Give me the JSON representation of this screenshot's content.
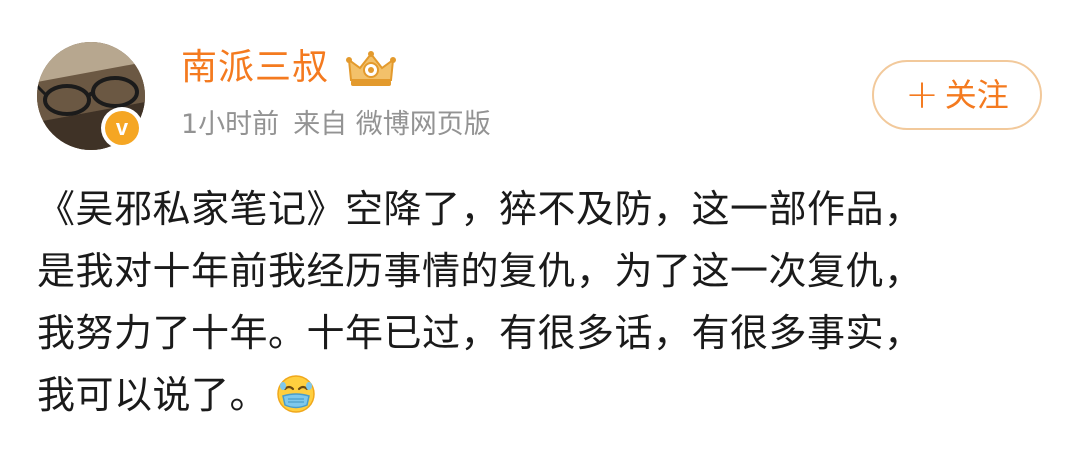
{
  "post": {
    "author": {
      "username": "南派三叔",
      "avatar_icon": "avatar-glasses-photo",
      "verified_icon": "verified-badge-icon",
      "verified_symbol": "v",
      "vip_icon": "crown-icon"
    },
    "meta": {
      "time": "1小时前",
      "source": "来自 微博网页版"
    },
    "follow_button": {
      "plus": "+",
      "label": "关注"
    },
    "content_lines": [
      "《吴邪私家笔记》空降了，猝不及防，这一部作品，",
      "是我对十年前我经历事情的复仇，为了这一次复仇，",
      "我努力了十年。十年已过，有很多话，有很多事实，",
      "我可以说了。"
    ],
    "emoji_icon": "face-with-mask-emoji",
    "colors": {
      "accent": "#f47a1f",
      "meta_gray": "#939393",
      "text": "#1a1a1a",
      "button_border": "#f2c99b"
    }
  }
}
